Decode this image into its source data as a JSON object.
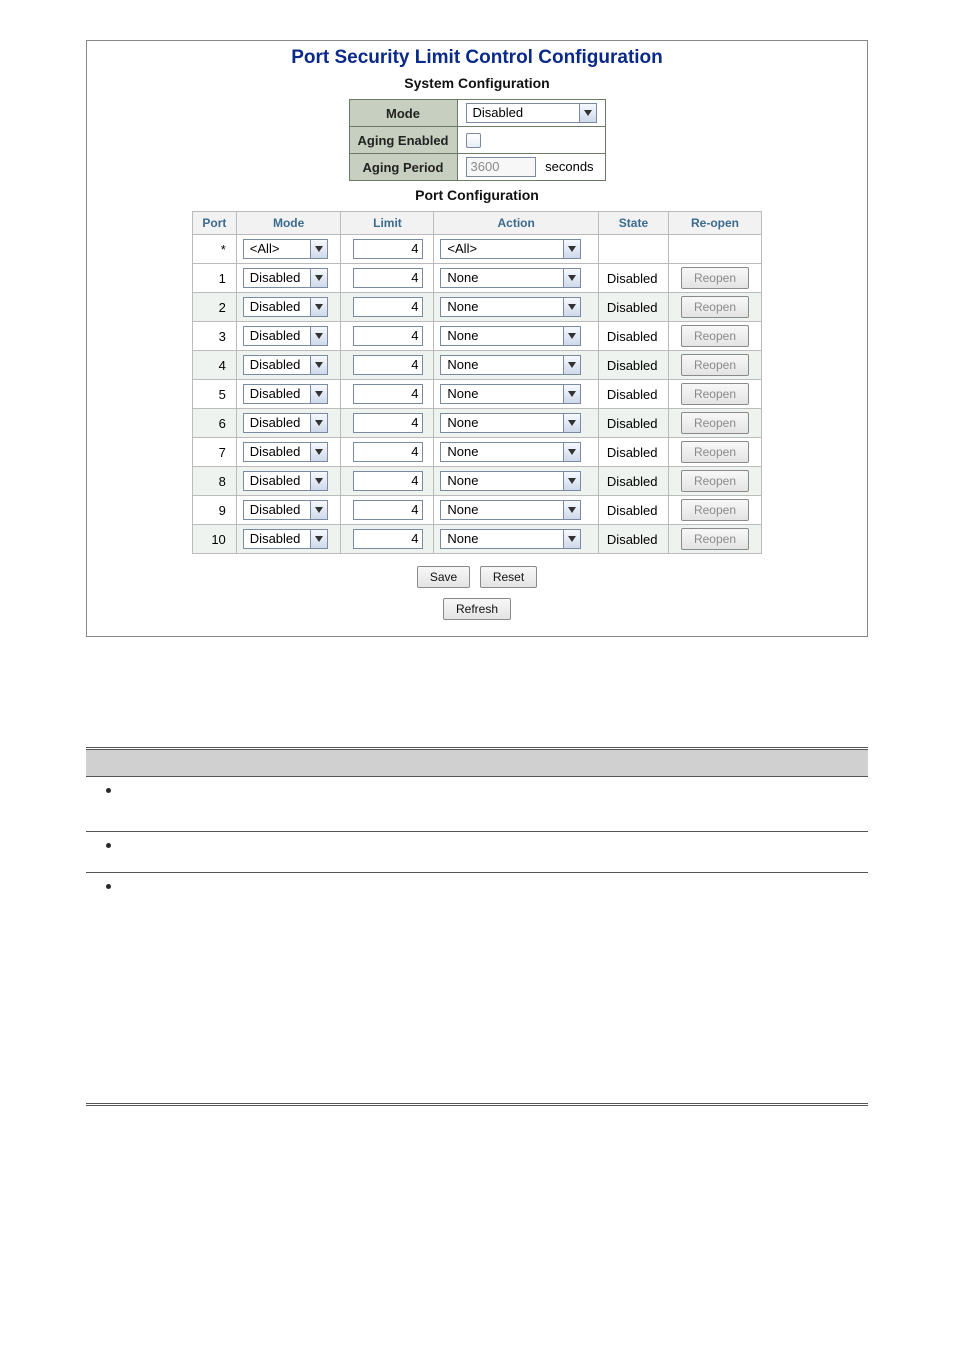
{
  "panel": {
    "title": "Port Security Limit Control Configuration",
    "sys_heading": "System Configuration",
    "port_heading": "Port Configuration"
  },
  "syscfg": {
    "mode_label": "Mode",
    "mode_value": "Disabled",
    "aging_enabled_label": "Aging Enabled",
    "aging_period_label": "Aging Period",
    "aging_period_value": "3600",
    "aging_period_unit": "seconds"
  },
  "portcfg": {
    "headers": {
      "port": "Port",
      "mode": "Mode",
      "limit": "Limit",
      "action": "Action",
      "state": "State",
      "reopen": "Re-open"
    },
    "wild_port": "*",
    "wild_mode": "<All>",
    "wild_limit": "4",
    "wild_action": "<All>",
    "rows": [
      {
        "port": "1",
        "mode": "Disabled",
        "limit": "4",
        "action": "None",
        "state": "Disabled",
        "reopen": "Reopen"
      },
      {
        "port": "2",
        "mode": "Disabled",
        "limit": "4",
        "action": "None",
        "state": "Disabled",
        "reopen": "Reopen"
      },
      {
        "port": "3",
        "mode": "Disabled",
        "limit": "4",
        "action": "None",
        "state": "Disabled",
        "reopen": "Reopen"
      },
      {
        "port": "4",
        "mode": "Disabled",
        "limit": "4",
        "action": "None",
        "state": "Disabled",
        "reopen": "Reopen"
      },
      {
        "port": "5",
        "mode": "Disabled",
        "limit": "4",
        "action": "None",
        "state": "Disabled",
        "reopen": "Reopen"
      },
      {
        "port": "6",
        "mode": "Disabled",
        "limit": "4",
        "action": "None",
        "state": "Disabled",
        "reopen": "Reopen"
      },
      {
        "port": "7",
        "mode": "Disabled",
        "limit": "4",
        "action": "None",
        "state": "Disabled",
        "reopen": "Reopen"
      },
      {
        "port": "8",
        "mode": "Disabled",
        "limit": "4",
        "action": "None",
        "state": "Disabled",
        "reopen": "Reopen"
      },
      {
        "port": "9",
        "mode": "Disabled",
        "limit": "4",
        "action": "None",
        "state": "Disabled",
        "reopen": "Reopen"
      },
      {
        "port": "10",
        "mode": "Disabled",
        "limit": "4",
        "action": "None",
        "state": "Disabled",
        "reopen": "Reopen"
      }
    ]
  },
  "buttons": {
    "save": "Save",
    "reset": "Reset",
    "refresh": "Refresh"
  }
}
